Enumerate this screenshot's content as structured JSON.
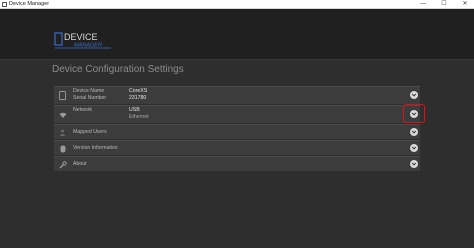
{
  "window": {
    "title": "Device Manager",
    "minimize_glyph": "—",
    "maximize_glyph": "☐",
    "close_glyph": "✕"
  },
  "header": {
    "logo_line1": "DEVICE",
    "logo_line2": "MANAGER"
  },
  "main": {
    "title": "Device Configuration Settings"
  },
  "rows": [
    {
      "icon": "device-icon",
      "labels": [
        "Device Name",
        "Serial Number"
      ],
      "values": [
        "CoreXS",
        "231780"
      ]
    },
    {
      "icon": "wifi-icon",
      "labels": [
        "Network"
      ],
      "values": [
        "USB",
        "Ethernet"
      ]
    },
    {
      "icon": "users-icon",
      "labels": [
        "Mapped Users"
      ]
    },
    {
      "icon": "database-icon",
      "labels": [
        "Version Information"
      ]
    },
    {
      "icon": "wrench-icon",
      "labels": [
        "About"
      ]
    }
  ],
  "colors": {
    "background": "#2e2e2e",
    "header": "#202020",
    "row": "#3c3c3c",
    "chevron": "#d9d9d9",
    "highlight": "#e01010",
    "logo": "#3b6ec9"
  }
}
